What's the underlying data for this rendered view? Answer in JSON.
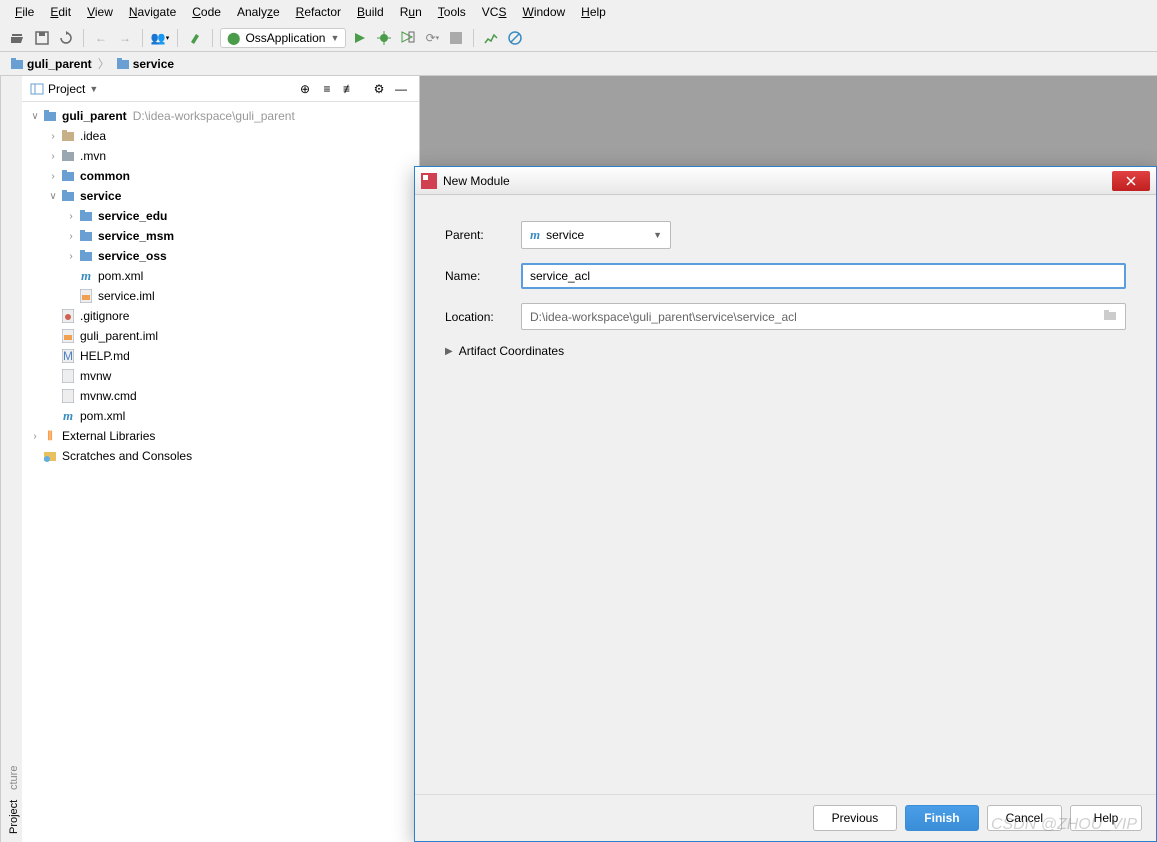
{
  "menubar": [
    "File",
    "Edit",
    "View",
    "Navigate",
    "Code",
    "Analyze",
    "Refactor",
    "Build",
    "Run",
    "Tools",
    "VCS",
    "Window",
    "Help"
  ],
  "run_config": "OssApplication",
  "breadcrumb": {
    "root": "guli_parent",
    "child": "service"
  },
  "panel": {
    "title": "Project"
  },
  "tree": {
    "project_name": "guli_parent",
    "project_path": "D:\\idea-workspace\\guli_parent",
    "idea": ".idea",
    "mvn": ".mvn",
    "common": "common",
    "service": "service",
    "service_edu": "service_edu",
    "service_msm": "service_msm",
    "service_oss": "service_oss",
    "pom_xml": "pom.xml",
    "service_iml": "service.iml",
    "gitignore": ".gitignore",
    "guli_parent_iml": "guli_parent.iml",
    "help_md": "HELP.md",
    "mvnw": "mvnw",
    "mvnw_cmd": "mvnw.cmd",
    "pom_xml2": "pom.xml",
    "external": "External Libraries",
    "scratches": "Scratches and Consoles"
  },
  "dialog": {
    "title": "New Module",
    "parent_label": "Parent:",
    "parent_value": "service",
    "name_label": "Name:",
    "name_value": "service_acl",
    "location_label": "Location:",
    "location_value": "D:\\idea-workspace\\guli_parent\\service\\service_acl",
    "artifact": "Artifact Coordinates",
    "previous": "Previous",
    "finish": "Finish",
    "cancel": "Cancel",
    "help": "Help"
  },
  "watermark": "CSDN @ZHOU_VIP"
}
